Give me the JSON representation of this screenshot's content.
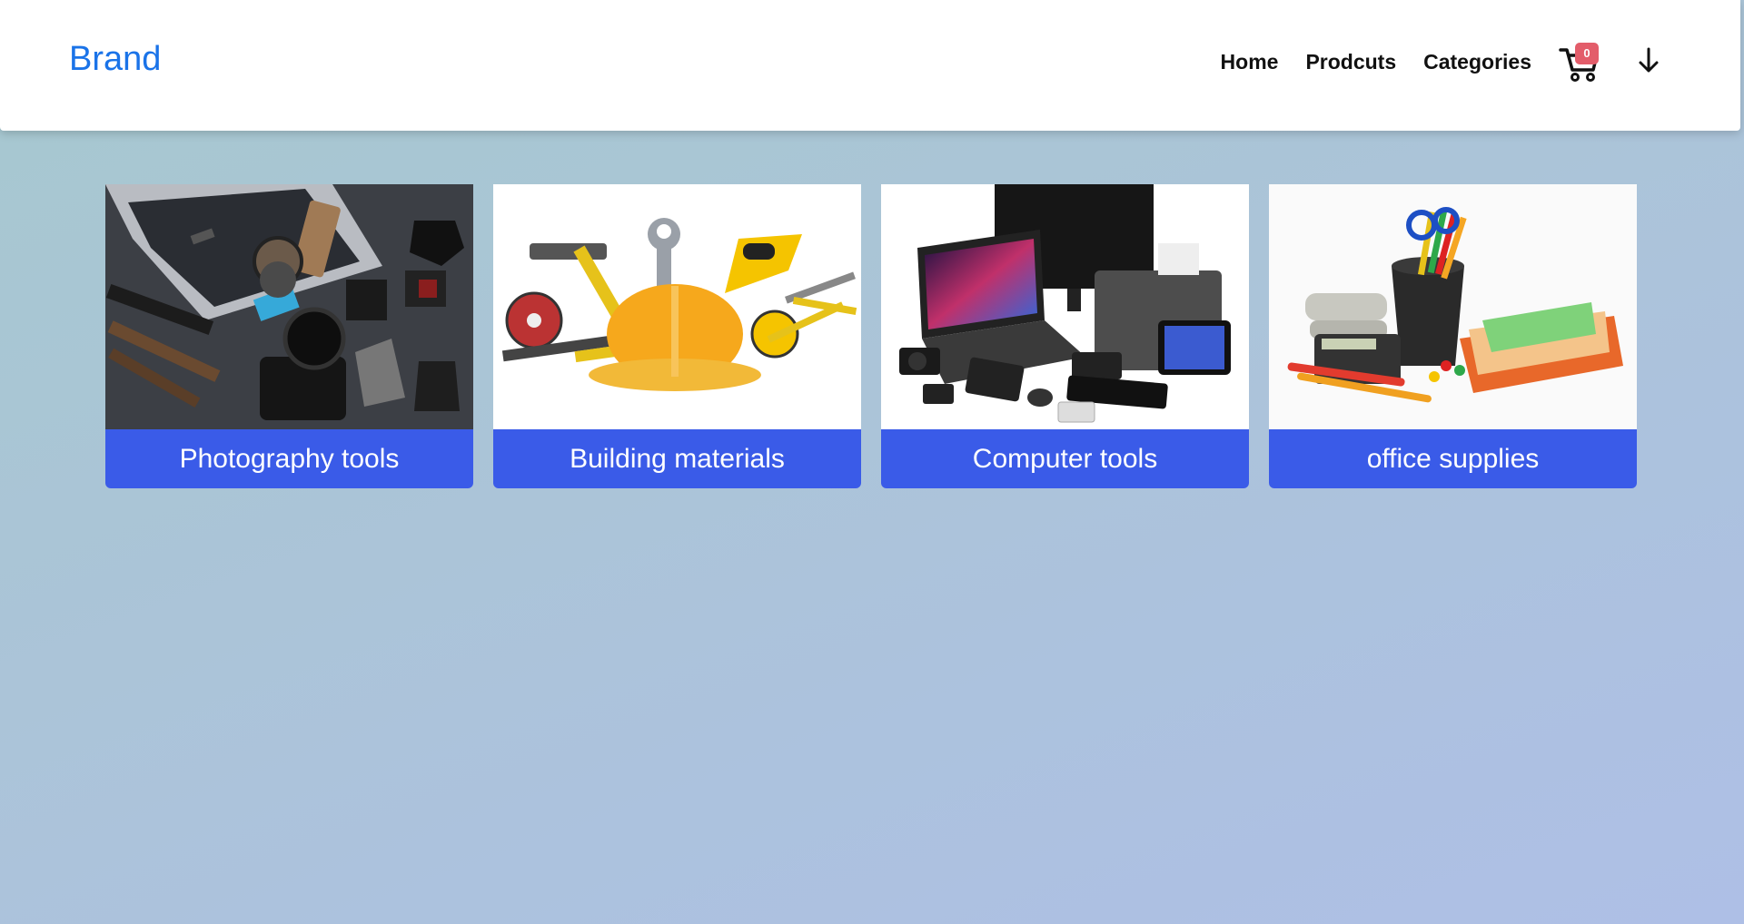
{
  "navbar": {
    "brand": "Brand",
    "links": [
      "Home",
      "Prodcuts",
      "Categories"
    ],
    "cart_count": "0",
    "cart_icon": "cart-icon",
    "menu_icon": "arrow-down-icon"
  },
  "colors": {
    "brand": "#1a73e8",
    "card_accent": "#3a5be8",
    "badge": "#e35d6a"
  },
  "categories": [
    {
      "title": "Photography tools",
      "image": "photography-tools-image"
    },
    {
      "title": "Building materials",
      "image": "building-materials-image"
    },
    {
      "title": "Computer tools",
      "image": "computer-tools-image"
    },
    {
      "title": "office supplies",
      "image": "office-supplies-image"
    }
  ]
}
